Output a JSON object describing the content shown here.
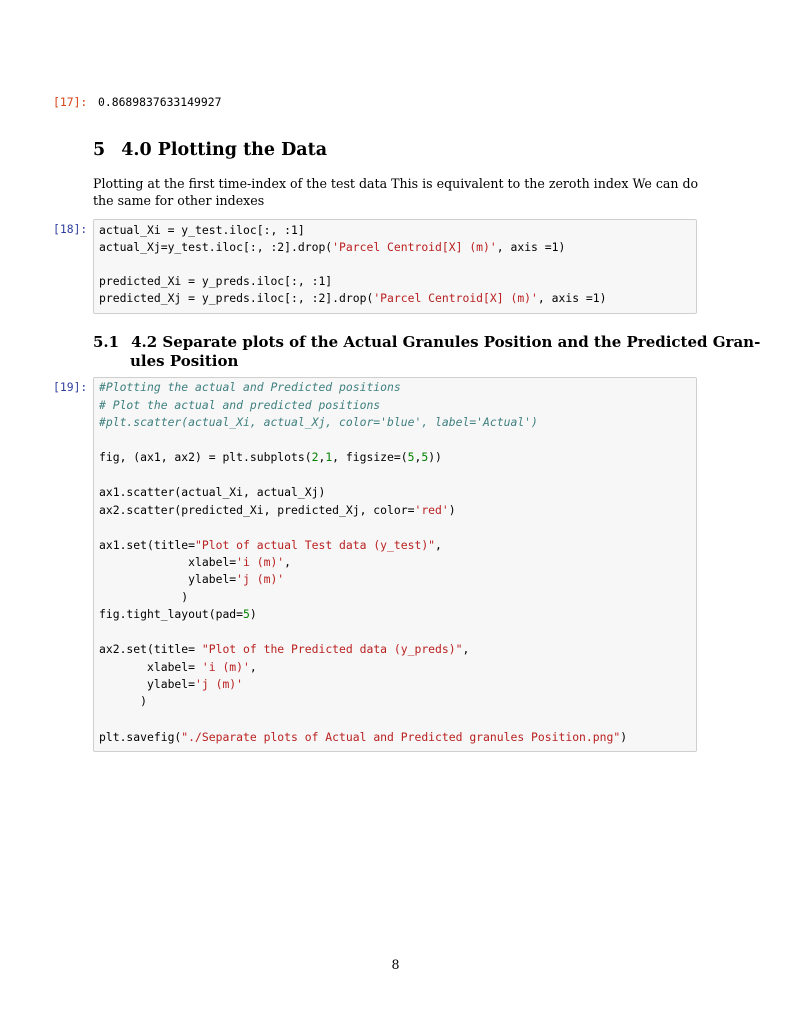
{
  "cell17": {
    "prompt": "[17]:",
    "output": "0.8689837633149927"
  },
  "section5": {
    "number": "5",
    "title": "4.0 Plotting the Data"
  },
  "paragraph": {
    "line1": "Plotting at the first time-index of the test data This is equivalent to the zeroth index We can do",
    "line2": "the same for other indexes"
  },
  "cell18": {
    "prompt": "[18]:",
    "lines": [
      [
        "actual_Xi = y_test.iloc[:, :1]"
      ],
      [
        "actual_Xj=y_test.iloc[:, :2].drop(",
        "'Parcel Centroid[X] (m)'",
        ", axis =1)"
      ],
      [
        ""
      ],
      [
        "predicted_Xi = y_preds.iloc[:, :1]"
      ],
      [
        "predicted_Xj = y_preds.iloc[:, :2].drop(",
        "'Parcel Centroid[X] (m)'",
        ", axis =1)"
      ]
    ]
  },
  "subsection51": {
    "number": "5.1",
    "title_line1": "4.2 Separate plots of the Actual Granules Position and the Predicted Gran-",
    "title_line2": "ules Position"
  },
  "cell19": {
    "prompt": "[19]:",
    "comment1": "#Plotting the actual and Predicted positions",
    "comment2": "# Plot the actual and predicted positions",
    "comment3": "#plt.scatter(actual_Xi, actual_Xj, color='blue', label='Actual')",
    "l_fig_a": "fig, (ax1, ax2) = plt.subplots(",
    "l_fig_b": "2",
    "l_fig_c": ",",
    "l_fig_d": "1",
    "l_fig_e": ", figsize=(",
    "l_fig_f": "5",
    "l_fig_g": ",",
    "l_fig_h": "5",
    "l_fig_i": "))",
    "l_sc1": "ax1.scatter(actual_Xi, actual_Xj)",
    "l_sc2_a": "ax2.scatter(predicted_Xi, predicted_Xj, color=",
    "l_sc2_b": "'red'",
    "l_sc2_c": ")",
    "l_set1_a": "ax1.set(title=",
    "l_set1_b": "\"Plot of actual Test data (y_test)\"",
    "l_set1_c": ",",
    "l_xl1_a": "             xlabel=",
    "l_xl1_b": "'i (m)'",
    "l_xl1_c": ",",
    "l_yl1_a": "             ylabel=",
    "l_yl1_b": "'j (m)'",
    "l_close1": "            )",
    "l_tight_a": "fig.tight_layout(pad=",
    "l_tight_b": "5",
    "l_tight_c": ")",
    "l_set2_a": "ax2.set(title= ",
    "l_set2_b": "\"Plot of the Predicted data (y_preds)\"",
    "l_set2_c": ",",
    "l_xl2_a": "       xlabel= ",
    "l_xl2_b": "'i (m)'",
    "l_xl2_c": ",",
    "l_yl2_a": "       ylabel=",
    "l_yl2_b": "'j (m)'",
    "l_close2": "      )",
    "l_save_a": "plt.savefig(",
    "l_save_b": "\"./Separate plots of Actual and Predicted granules Position.png\"",
    "l_save_c": ")"
  },
  "page_number": "8"
}
